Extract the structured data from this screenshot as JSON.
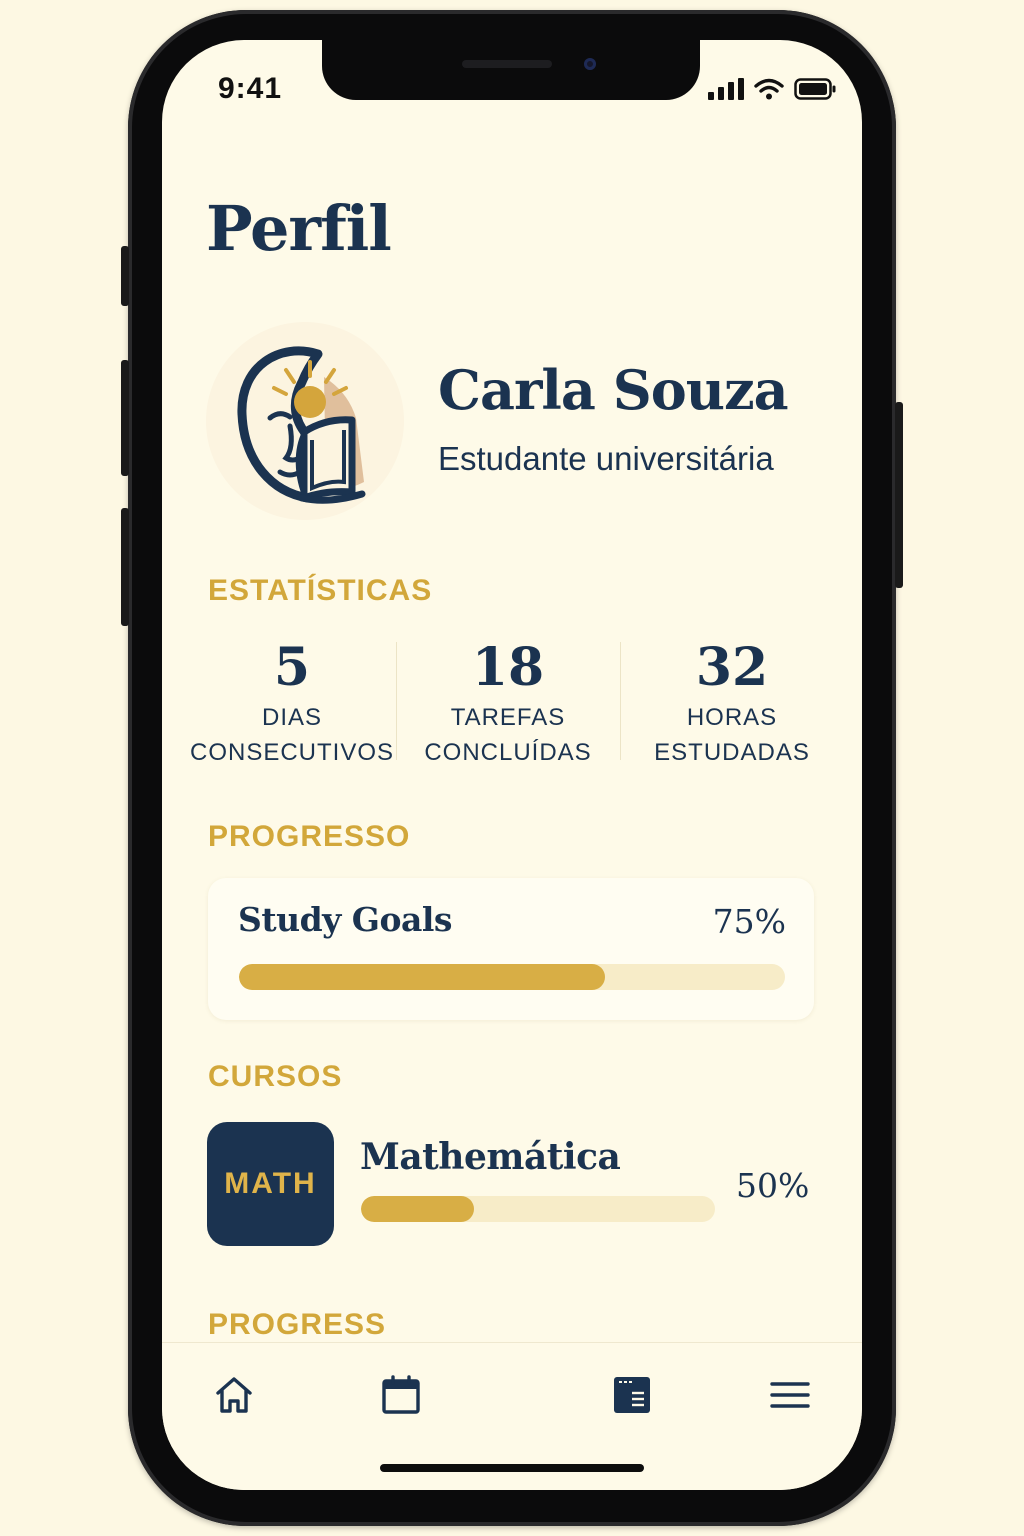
{
  "status_bar": {
    "time": "9:41"
  },
  "page": {
    "title": "Perfil"
  },
  "profile": {
    "name": "Carla Souza",
    "role": "Estudante universitária",
    "avatar_icon": "reading-mind-logo-icon"
  },
  "stats": {
    "heading": "ESTATÍSTICAS",
    "items": [
      {
        "value": "5",
        "label_line1": "DIAS",
        "label_line2": "CONSECUTIVOS"
      },
      {
        "value": "18",
        "label_line1": "TAREFAS",
        "label_line2": "CONCLUÍDAS"
      },
      {
        "value": "32",
        "label_line1": "HORAS",
        "label_line2": "ESTUDADAS"
      }
    ]
  },
  "progress": {
    "heading": "PROGRESSO",
    "goal_title": "Study Goals",
    "goal_percent_label": "75%",
    "goal_bar_fraction": 0.67
  },
  "courses": {
    "heading": "CURSOS",
    "items": [
      {
        "badge": "MATH",
        "name": "Mathemática",
        "percent_label": "50%",
        "bar_fraction": 0.32
      }
    ]
  },
  "next_section": {
    "heading": "PROGRESS"
  },
  "tab_bar": {
    "items": [
      {
        "icon": "home-icon"
      },
      {
        "icon": "calendar-icon"
      },
      {
        "icon": "book-icon",
        "active": true
      },
      {
        "icon": "menu-icon"
      }
    ]
  },
  "colors": {
    "navy": "#1b3350",
    "gold": "#d2a73a",
    "background": "#fefae8",
    "track": "#f7ecc8"
  }
}
